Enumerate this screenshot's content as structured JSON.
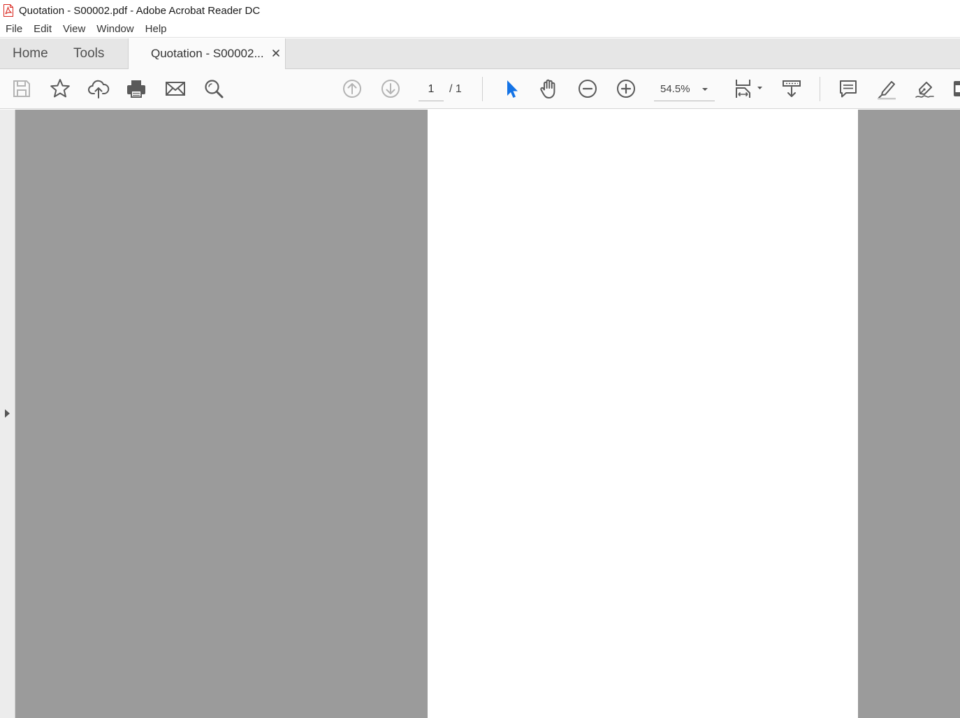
{
  "window": {
    "title": "Quotation - S00002.pdf - Adobe Acrobat Reader DC"
  },
  "menu": {
    "items": [
      "File",
      "Edit",
      "View",
      "Window",
      "Help"
    ]
  },
  "tabs": {
    "home": "Home",
    "tools": "Tools",
    "document": "Quotation - S00002..."
  },
  "toolbar": {
    "page_current": "1",
    "page_total": "/  1",
    "zoom": "54.5%",
    "icons": {
      "save": "save-icon",
      "bookmark": "star-icon",
      "upload": "cloud-upload-icon",
      "print": "print-icon",
      "email": "mail-icon",
      "find": "search-icon",
      "prev_page": "arrow-up-circle-icon",
      "next_page": "arrow-down-circle-icon",
      "select": "pointer-icon",
      "hand": "hand-icon",
      "zoom_out": "minus-circle-icon",
      "zoom_in": "plus-circle-icon",
      "fit_page": "fit-page-icon",
      "scroll_mode": "scroll-mode-icon",
      "comment": "comment-icon",
      "highlight": "highlighter-icon",
      "sign": "fountain-pen-icon"
    }
  },
  "colors": {
    "accent": "#1473e6",
    "canvas": "#9b9b9b",
    "icon": "#5a5a5a",
    "icon_disabled": "#b4b4b4",
    "pdf_red": "#d9251d"
  }
}
